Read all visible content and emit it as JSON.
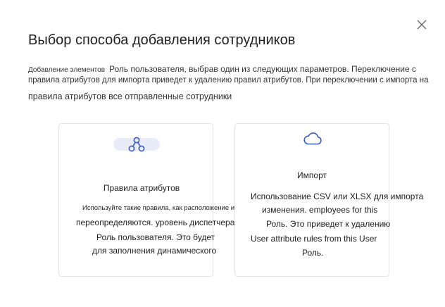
{
  "dialog": {
    "title": "Выбор способа добавления сотрудников",
    "close_label": "×",
    "description": {
      "line1_small": "Добавление элементов",
      "line1_rest": "Роль пользователя, выбрав один из следующих параметров. Переключение с",
      "line2": "правила атрибутов для импорта приведет к удалению правил атрибутов. При переключении с импорта на",
      "line3": "правила атрибутов все отправленные сотрудники"
    }
  },
  "options": {
    "attribute_rules": {
      "title": "Правила атрибутов",
      "icon": "connection-nodes-icon",
      "lines": [
        "Используйте такие правила, как расположение или",
        "переопределяются. уровень диспетчера",
        "Роль пользователя. Это будет",
        "для заполнения динамического"
      ]
    },
    "import": {
      "title": "Импорт",
      "icon": "cloud-icon",
      "lines": [
        "Использование CSV или XLSX для импорта",
        "изменения. employees for this",
        "Роль. Это приведет к удалению",
        "User attribute rules from this User",
        "Роль."
      ]
    }
  },
  "colors": {
    "accent": "#3b5cc4",
    "pill": "#e8ecf8",
    "border": "#e3e3e3"
  }
}
